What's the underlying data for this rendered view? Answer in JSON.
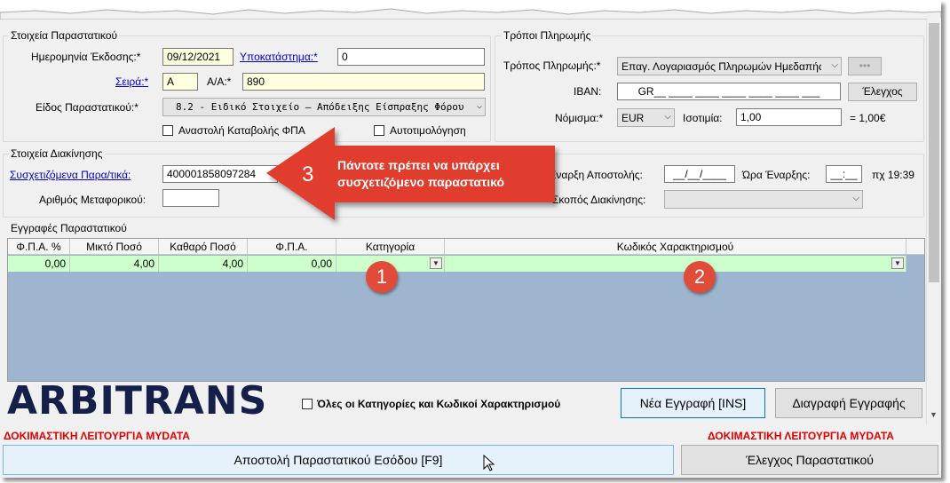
{
  "doc_group": {
    "title": "Στοιχεία Παραστατικού",
    "issue_date_label": "Ημερομηνία Έκδοσης:*",
    "issue_date_value": "09/12/2021",
    "branch_label": "Υποκατάστημα:*",
    "branch_value": "0",
    "series_label": "Σειρά:*",
    "series_value": "A",
    "aa_label": "Α/Α:*",
    "aa_value": "890",
    "doc_type_label": "Είδος Παραστατικού:*",
    "doc_type_value": "8.2 - Ειδικό Στοιχείο – Απόδειξης Είσπραξης Φόρου",
    "vat_suspension_label": "Αναστολή Καταβολής ΦΠΑ",
    "self_billing_label": "Αυτοτιμολόγηση"
  },
  "payment_group": {
    "title": "Τρόποι Πληρωμής",
    "method_label": "Τρόπος Πληρωμής:*",
    "method_value": "Επαγ. Λογαριασμός Πληρωμών Ημεδαπής",
    "more_button": "•••",
    "iban_label": "IBAN:",
    "iban_value": "GR__ ____ ____ ____ ____ ____ ___",
    "check_button": "Έλεγχος",
    "currency_label": "Νόμισμα:*",
    "currency_value": "EUR",
    "parity_label": "Ισοτιμία:",
    "parity_value": "1,00",
    "parity_result": "= 1,00€"
  },
  "movement_group": {
    "title": "Στοιχεία Διακίνησης",
    "related_label": "Συσχετιζόμενα Παρα/τικά:",
    "related_value": "400001858097284",
    "vehicle_label": "Αριθμός Μεταφορικού:",
    "vehicle_value": "",
    "start_label": "Έναρξη Αποστολής:",
    "start_date_value": "__/__/____",
    "start_time_label": "Ώρα Έναρξης:",
    "start_time_value": "__:__",
    "start_time_hint": "πχ 19:39",
    "purpose_label": "Σκοπός Διακίνησης:"
  },
  "entries_group": {
    "title": "Εγγραφές Παραστατικού",
    "columns": [
      "Φ.Π.Α. %",
      "Μικτό Ποσό",
      "Καθαρό Ποσό",
      "Φ.Π.Α.",
      "Κατηγορία",
      "Κωδικός Χαρακτηρισμού"
    ],
    "rows": [
      {
        "vat_pct": "0,00",
        "gross": "4,00",
        "net": "4,00",
        "vat": "0,00",
        "category": "",
        "code": ""
      }
    ]
  },
  "callout": {
    "number": "3",
    "text_line1": "Πάντοτε πρέπει να υπάρχει",
    "text_line2": "συσχετιζόμενο παραστατικό",
    "badge1": "1",
    "badge2": "2"
  },
  "bottom": {
    "logo": "ARBITRANS",
    "all_categories_label": "Όλες οι Κατηγορίες και Κωδικοί Χαρακτηρισμού",
    "new_entry_button": "Νέα Εγγραφή [INS]",
    "delete_entry_button": "Διαγραφή Εγγραφής",
    "test_mode_left": "ΔΟΚΙΜΑΣΤΙΚΗ ΛΕΙΤΟΥΡΓΙΑ MYDATA",
    "test_mode_right": "ΔΟΚΙΜΑΣΤΙΚΗ ΛΕΙΤΟΥΡΓΙΑ MYDATA",
    "send_button": "Αποστολή Παραστατικού Εσόδου [F9]",
    "validate_button": "Έλεγχος Παραστατικού"
  },
  "colors": {
    "callout_red": "#e03c2e",
    "grid_row": "#ccffcc",
    "grid_bg": "#9db5cf",
    "test_mode_red": "#e00000",
    "logo_navy": "#15204a"
  }
}
